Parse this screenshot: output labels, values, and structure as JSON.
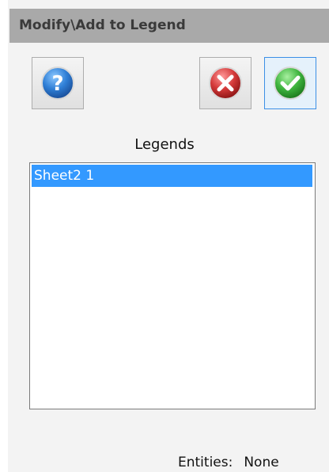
{
  "window": {
    "title": "Modify\\Add to Legend"
  },
  "toolbar": {
    "help_icon": "help-question-icon",
    "cancel_icon": "cancel-x-icon",
    "ok_icon": "confirm-check-icon"
  },
  "legends": {
    "label": "Legends",
    "items": [
      {
        "label": "Sheet2 1",
        "selected": true
      }
    ]
  },
  "entities": {
    "label": "Entities:",
    "value": "None"
  },
  "colors": {
    "title_bar": "#a9a9a9",
    "selection": "#3399ff",
    "help_blue": "#2f7fd6",
    "cancel_red": "#d43a3a",
    "ok_green": "#3fb53f"
  }
}
